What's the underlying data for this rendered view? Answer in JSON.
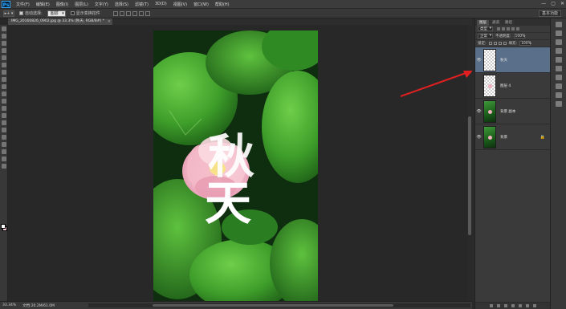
{
  "app": {
    "logo": "Ps"
  },
  "menu": [
    "文件(F)",
    "编辑(E)",
    "图像(I)",
    "图层(L)",
    "文字(Y)",
    "选择(S)",
    "滤镜(T)",
    "3D(D)",
    "视图(V)",
    "窗口(W)",
    "帮助(H)"
  ],
  "window_controls": {
    "minimize": "—",
    "maximize": "▢",
    "close": "✕"
  },
  "options": {
    "tool_label": "▸+ ▾",
    "auto_select_label": "自动选择:",
    "auto_select_target": "图层",
    "show_transform_label": "显示变换控件",
    "workspace": "基本功能"
  },
  "document": {
    "tab_title": "IMG_20160826_0902.jpg @ 33.3% (秋天, RGB/8#) *",
    "close": "×"
  },
  "artwork": {
    "char_1": "秋",
    "char_2": "天"
  },
  "status": {
    "zoom": "33.34%",
    "doc_info": "文档:20.2M/61.0M"
  },
  "layers_panel": {
    "tabs": [
      "图层",
      "通道",
      "路径"
    ],
    "filter_kind": "类型",
    "blend_mode": "正常",
    "opacity_label": "不透明度:",
    "opacity_value": "100%",
    "lock_label": "锁定:",
    "fill_label": "填充:",
    "fill_value": "100%",
    "layers": [
      {
        "name": "秋天",
        "thumb": "checker",
        "visible": true,
        "selected": true,
        "locked": false
      },
      {
        "name": "图层 4",
        "thumb": "checker-dot",
        "visible": false,
        "selected": false,
        "locked": false
      },
      {
        "name": "背景 副本",
        "thumb": "photo",
        "visible": true,
        "selected": false,
        "locked": false
      },
      {
        "name": "背景",
        "thumb": "photo",
        "visible": true,
        "selected": false,
        "locked": true
      }
    ]
  },
  "colors": {
    "foreground": "#ffffff",
    "background": "#f2c6d2",
    "selected_layer": "#5a6f8a",
    "arrow": "#e02020"
  },
  "icons": [
    "eye-icon",
    "lock-icon",
    "close-icon",
    "chevron-down-icon"
  ]
}
